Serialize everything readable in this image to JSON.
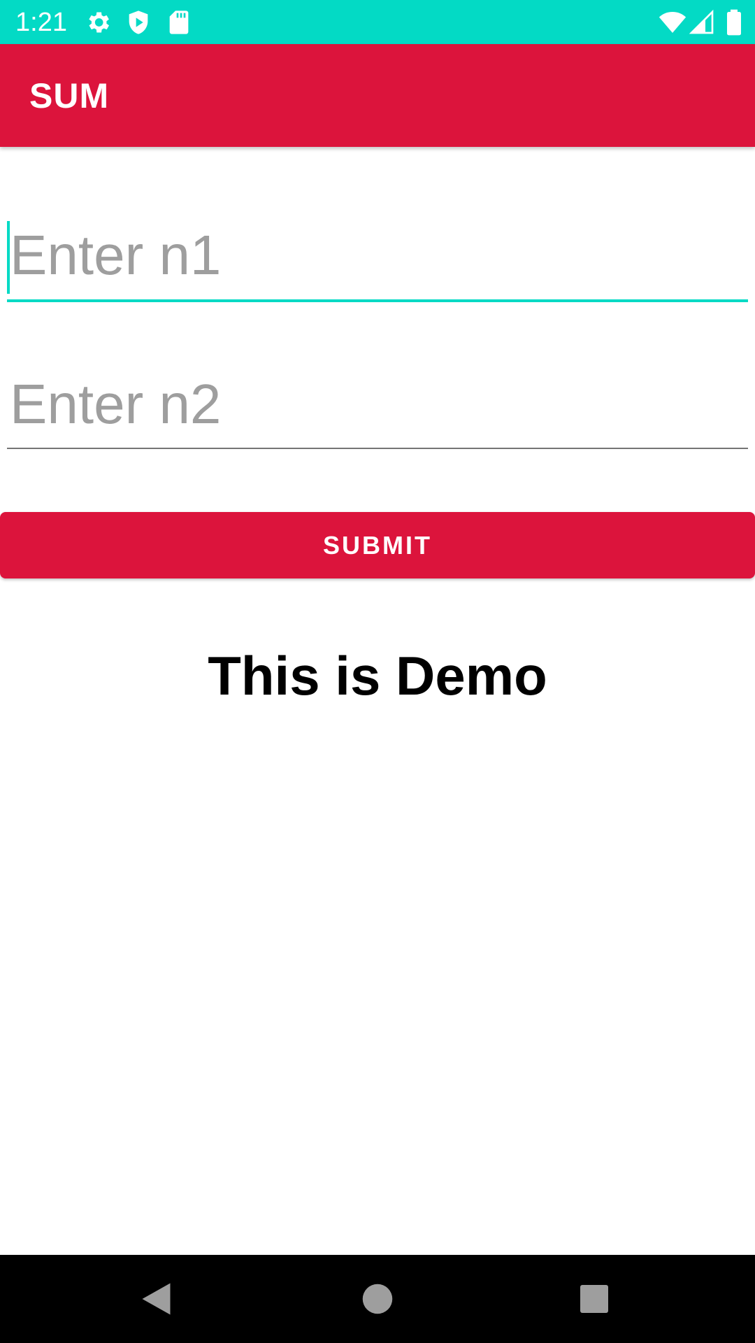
{
  "status_bar": {
    "time": "1:21",
    "bg_color": "#03dac5",
    "left_icons": [
      "gear-icon",
      "shield-play-icon",
      "sd-card-icon"
    ],
    "right_icons": [
      "wifi-icon",
      "cell-signal-icon",
      "battery-icon"
    ]
  },
  "app_bar": {
    "title": "SUM",
    "bg_color": "#dc143c"
  },
  "form": {
    "n1": {
      "value": "",
      "placeholder": "Enter n1",
      "focused": true
    },
    "n2": {
      "value": "",
      "placeholder": "Enter n2",
      "focused": false
    },
    "submit_label": "SUBMIT",
    "accent_color": "#03dac5",
    "button_color": "#dc143c"
  },
  "result": {
    "text": "This is Demo"
  },
  "nav_bar": {
    "buttons": [
      "back-icon",
      "home-icon",
      "recents-icon"
    ]
  }
}
